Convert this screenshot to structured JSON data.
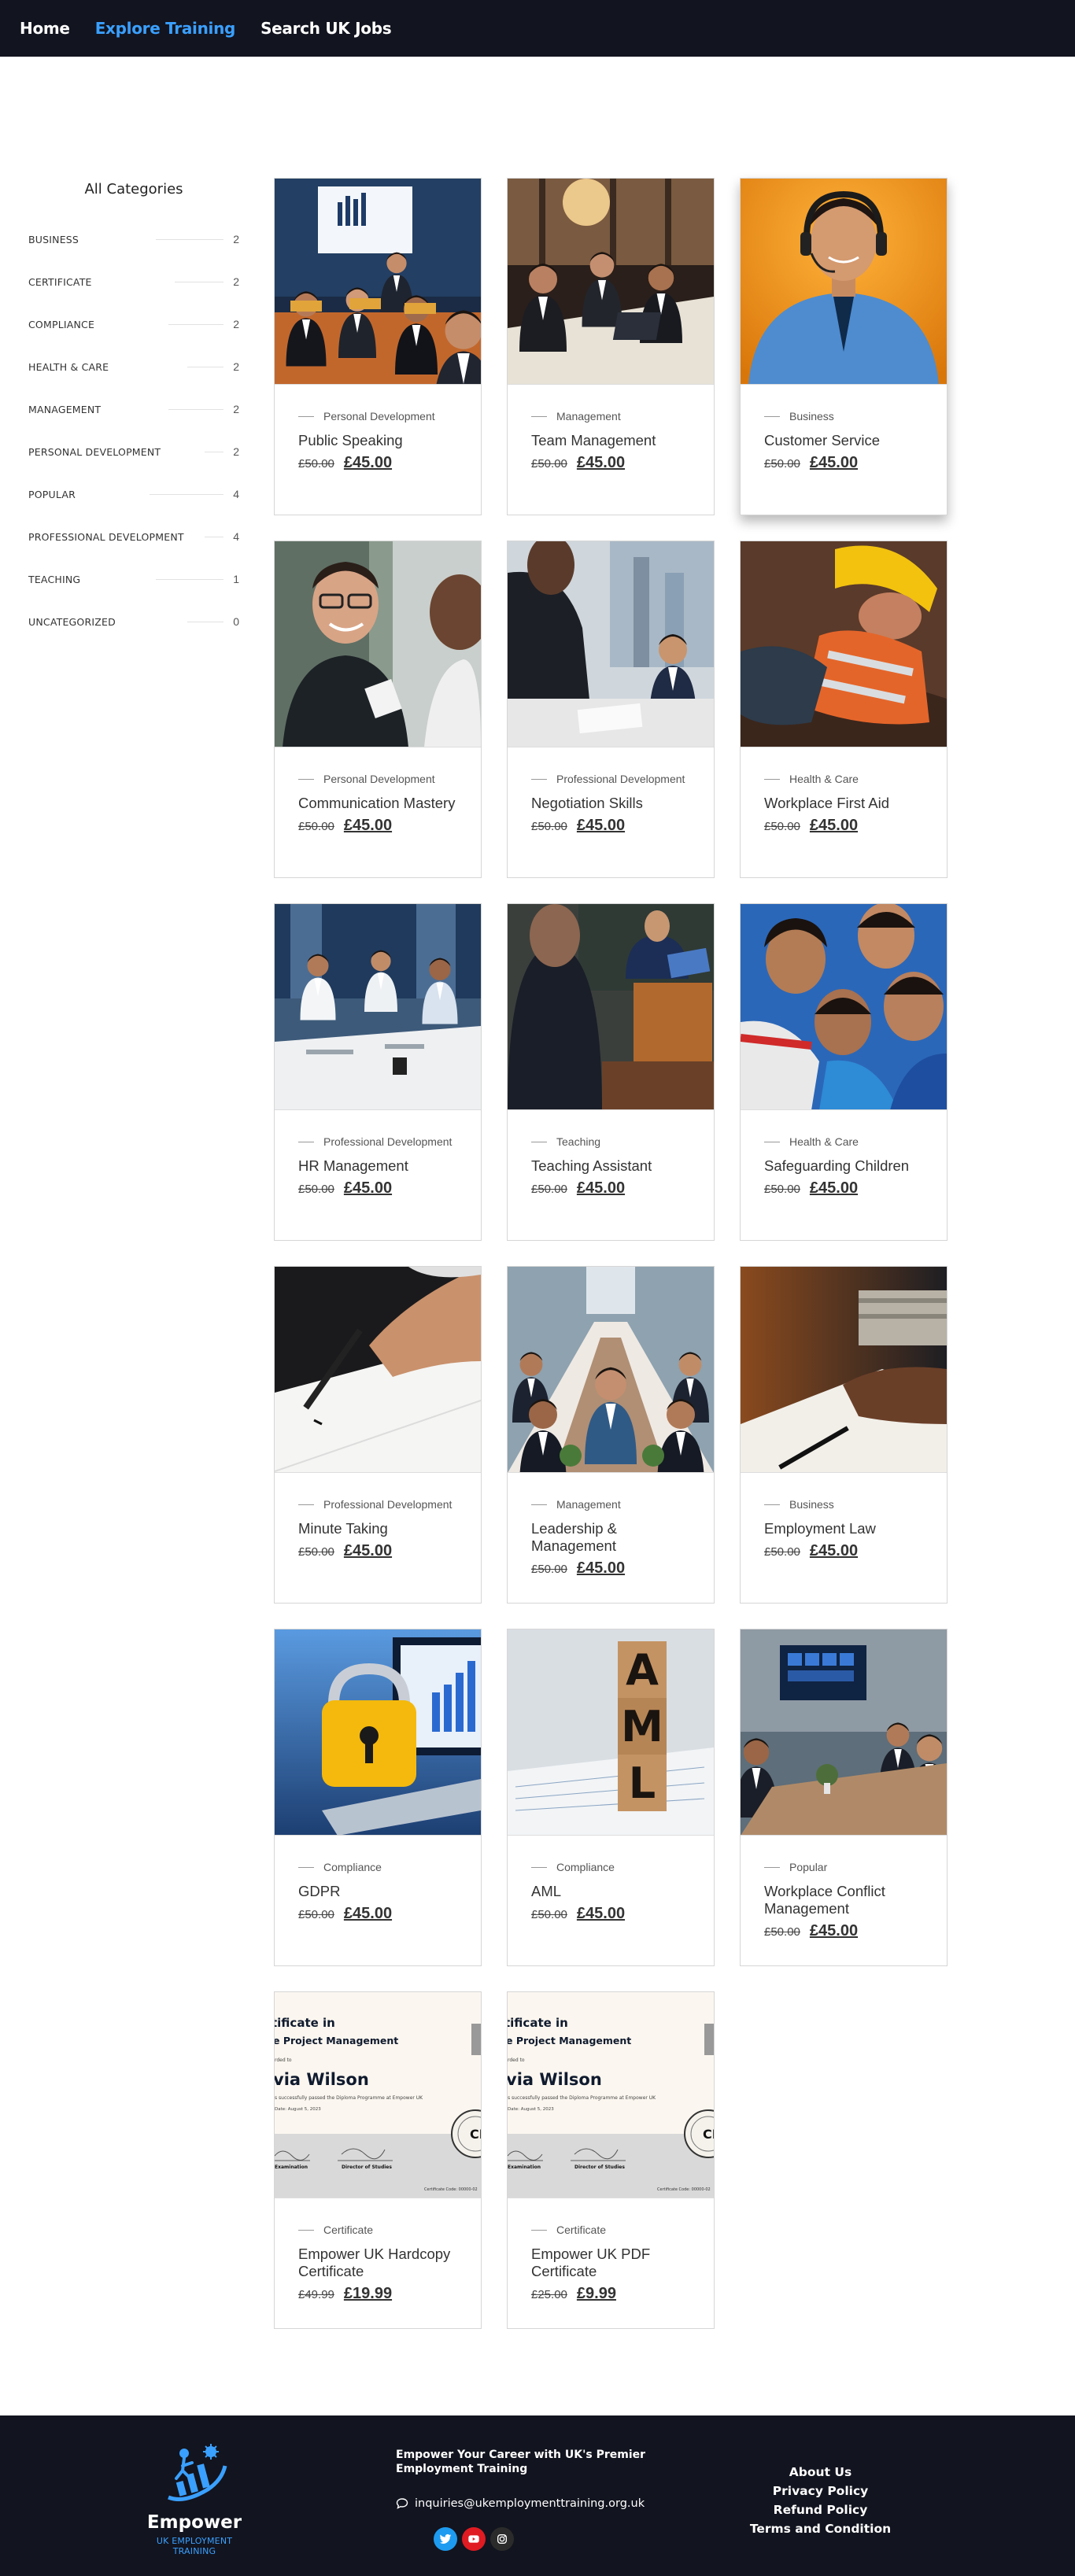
{
  "nav": {
    "items": [
      {
        "label": "Home",
        "active": false
      },
      {
        "label": "Explore Training",
        "active": true
      },
      {
        "label": "Search UK Jobs",
        "active": false
      }
    ],
    "accent": "#3aa0ff",
    "background": "#12141f"
  },
  "sidebar": {
    "title": "All Categories",
    "categories": [
      {
        "name": "BUSINESS",
        "count": "2"
      },
      {
        "name": "CERTIFICATE",
        "count": "2"
      },
      {
        "name": "COMPLIANCE",
        "count": "2"
      },
      {
        "name": "HEALTH & CARE",
        "count": "2"
      },
      {
        "name": "MANAGEMENT",
        "count": "2"
      },
      {
        "name": "PERSONAL DEVELOPMENT",
        "count": "2"
      },
      {
        "name": "POPULAR",
        "count": "4"
      },
      {
        "name": "PROFESSIONAL DEVELOPMENT",
        "count": "4"
      },
      {
        "name": "TEACHING",
        "count": "1"
      },
      {
        "name": "UNCATEGORIZED",
        "count": "0"
      }
    ]
  },
  "products": [
    {
      "category": "Personal Development",
      "title": "Public Speaking",
      "old_price": "£50.00",
      "price": "£45.00",
      "image": "presentation-photo"
    },
    {
      "category": "Management",
      "title": "Team Management",
      "old_price": "£50.00",
      "price": "£45.00",
      "image": "meeting-photo"
    },
    {
      "category": "Business",
      "title": "Customer Service",
      "old_price": "£50.00",
      "price": "£45.00",
      "image": "headset-agent-photo"
    },
    {
      "category": "Personal Development",
      "title": "Communication Mastery",
      "old_price": "£50.00",
      "price": "£45.00",
      "image": "conversation-photo"
    },
    {
      "category": "Professional Development",
      "title": "Negotiation Skills",
      "old_price": "£50.00",
      "price": "£45.00",
      "image": "negotiation-photo"
    },
    {
      "category": "Health & Care",
      "title": "Workplace First Aid",
      "old_price": "£50.00",
      "price": "£45.00",
      "image": "first-aid-photo"
    },
    {
      "category": "Professional Development",
      "title": "HR Management",
      "old_price": "£50.00",
      "price": "£45.00",
      "image": "hr-meeting-photo"
    },
    {
      "category": "Teaching",
      "title": "Teaching Assistant",
      "old_price": "£50.00",
      "price": "£45.00",
      "image": "classroom-photo"
    },
    {
      "category": "Health & Care",
      "title": "Safeguarding Children",
      "old_price": "£50.00",
      "price": "£45.00",
      "image": "children-photo"
    },
    {
      "category": "Professional Development",
      "title": "Minute Taking",
      "old_price": "£50.00",
      "price": "£45.00",
      "image": "writing-photo"
    },
    {
      "category": "Management",
      "title": "Leadership & Management",
      "old_price": "£50.00",
      "price": "£45.00",
      "image": "boardroom-photo"
    },
    {
      "category": "Business",
      "title": "Employment Law",
      "old_price": "£50.00",
      "price": "£45.00",
      "image": "signing-photo"
    },
    {
      "category": "Compliance",
      "title": "GDPR",
      "old_price": "£50.00",
      "price": "£45.00",
      "image": "padlock-laptop-photo"
    },
    {
      "category": "Compliance",
      "title": "AML",
      "old_price": "£50.00",
      "price": "£45.00",
      "image": "aml-blocks-photo"
    },
    {
      "category": "Popular",
      "title": "Workplace Conflict Management",
      "old_price": "£50.00",
      "price": "£45.00",
      "image": "conference-room-photo"
    },
    {
      "category": "Certificate",
      "title": "Empower UK Hardcopy Certificate",
      "old_price": "£49.99",
      "price": "£19.99",
      "image": "certificate-image"
    },
    {
      "category": "Certificate",
      "title": "Empower UK PDF Certificate",
      "old_price": "£25.00",
      "price": "£9.99",
      "image": "certificate-image"
    }
  ],
  "certificate": {
    "heading1": "tificate in",
    "heading2": "e Project Management",
    "awarded": "rded to",
    "name": "via Wilson",
    "line": "s successfully passed the Diploma Programme at Empower UK",
    "date": "Date: August 5, 2023",
    "sig1": "Examination",
    "sig2": "Director of Studies",
    "seal": "CP",
    "code": "Certificate Code: 00000-02"
  },
  "aml_blocks": [
    "A",
    "M",
    "L"
  ],
  "footer": {
    "logo_name": "Empower",
    "logo_sub": "UK EMPLOYMENT TRAINING",
    "tagline": "Empower Your Career with UK's Premier Employment Training",
    "email": "inquiries@ukemploymenttraining.org.uk",
    "social": [
      "twitter-icon",
      "youtube-icon",
      "instagram-icon"
    ],
    "links": [
      "About Us",
      "Privacy Policy",
      "Refund Policy",
      "Terms and Condition"
    ]
  }
}
